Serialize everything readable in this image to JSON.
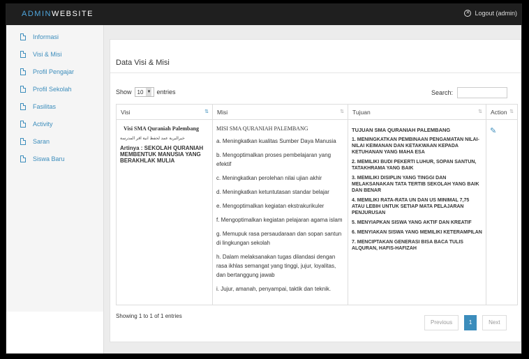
{
  "brand": {
    "part1": "ADMIN",
    "part2": "WEBSITE"
  },
  "topbar": {
    "logout_label": "Logout (admin)",
    "logout_icon": "circle-x-icon"
  },
  "sidebar": {
    "items": [
      {
        "label": "Informasi"
      },
      {
        "label": "Visi & Misi"
      },
      {
        "label": "Profil Pengajar"
      },
      {
        "label": "Profil Sekolah"
      },
      {
        "label": "Fasilitas"
      },
      {
        "label": "Activity"
      },
      {
        "label": "Saran"
      },
      {
        "label": "Siswa Baru"
      }
    ]
  },
  "panel": {
    "title": "Data Visi & Misi",
    "show_label": "Show",
    "show_value": "10",
    "entries_label": "entries",
    "search_label": "Search:"
  },
  "table": {
    "headers": [
      "Visi",
      "Misi",
      "Tujuan",
      "Action"
    ],
    "row": {
      "visi_title": "Visi SMA Quraniah Palembang",
      "visi_arabic": "خيرالبرية عمد لحفظ انية اقر المدرسة",
      "visi_artinya": "Artinya : SEKOLAH QURANIAH MEMBENTUK MANUSIA YANG BERAKHLAK MULIA",
      "misi_title": "MISI SMA QURANIAH PALEMBANG",
      "misi_items": [
        "a.   Meningkatkan kualitas Sumber Daya Manusia",
        "b.   Mengoptimalkan proses pembelajaran yang efektif",
        "c.   Meningkatkan perolehan nilai ujian akhir",
        "d.   Meningkatkan ketuntutasan standar belajar",
        "e.   Mengoptimalkan kegiatan ekstrakurikuler",
        "f.   Mengoptimalkan kegiatan pelajaran agama islam",
        "g.   Memupuk rasa persaudaraan dan sopan santun di lingkungan sekolah",
        "h.   Dalam melaksanakan tugas dilandasi dengan rasa ikhlas semangat yang tinggi, jujur, loyalitas, dan bertanggung jawab",
        "i.   Jujur, amanah, penyampai, taktik dan teknik."
      ],
      "tujuan_title": "TUJUAN SMA QURANIAH PALEMBANG",
      "tujuan_items": [
        "1. MENINGKATKAN PEMBINAAN PENGAMATAN NILAI-NILAI KEIMANAN DAN KETAKWAAN KEPADA KETUHANAN YANG MAHA ESA",
        "2. MEMILIKI BUDI PEKERTI LUHUR, SOPAN SANTUN, TATAKHRAMA YANG BAIK",
        "3. MEMILIKI DISIPLIN YANG TINGGI DAN MELAKSANAKAN TATA TERTIB SEKOLAH YANG BAIK DAN BENAR",
        "4. MEMILIKI RATA-RATA UN DAN US MINIMAL 7,75 ATAU LEBIH UNTUK SETIAP MATA PELAJARAN PENJURUSAN",
        "5. MENYIAPKAN SISWA YANG AKTIF DAN KREATIF",
        "6. MENYIAKAN SISWA YANG MEMILIKI KETERAMPILAN",
        "7. MENCIPTAKAN GENERASI BISA BACA TULIS ALQURAN, HAFIS-HAFIZAH"
      ],
      "action_icon": "pencil-icon"
    }
  },
  "footer": {
    "showing": "Showing 1 to 1 of 1 entries",
    "previous": "Previous",
    "page": "1",
    "next": "Next"
  },
  "colors": {
    "accent": "#3c8dbc",
    "topbar": "#1f1f1f",
    "brand_accent": "#4fa6dd"
  }
}
